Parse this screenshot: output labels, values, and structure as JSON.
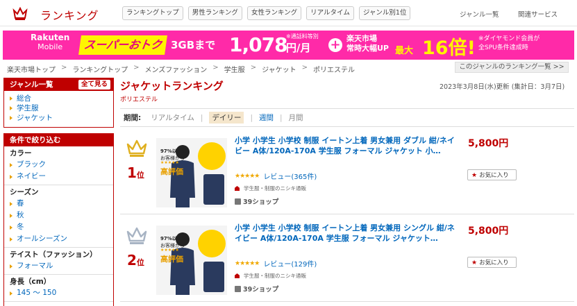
{
  "header": {
    "logo_text": "ランキング",
    "tabs": [
      "ランキングトップ",
      "男性ランキング",
      "女性ランキング",
      "リアルタイム",
      "ジャンル別1位"
    ],
    "right_links": [
      "ジャンル一覧",
      "関連サービス"
    ]
  },
  "banner": {
    "brand_top": "Rakuten",
    "brand_bottom": "Mobile",
    "super_deal": "スーパーおトク",
    "plan": "3GBまで",
    "price": "1,078",
    "price_unit": "円/月",
    "price_note": "※通話料等別",
    "ichiba_line1": "楽天市場",
    "ichiba_line2": "常時大幅UP",
    "max_label": "最大",
    "multiplier": "16倍!",
    "note_line1": "※ダイヤモンド会員が",
    "note_line2": "全SPU条件達成時"
  },
  "breadcrumb": [
    "楽天市場トップ",
    "ランキングトップ",
    "メンズファッション",
    "学生服",
    "ジャケット",
    "ポリエステル"
  ],
  "genre_list_link": "このジャンルのランキング一覧 >>",
  "sidebar": {
    "genre_title": "ジャンル一覧",
    "all_button": "全て見る",
    "genres": [
      "総合",
      "学生服",
      "ジャケット"
    ],
    "filter_title": "条件で絞り込む",
    "filters": [
      {
        "title": "カラー",
        "items": [
          "ブラック",
          "ネイビー"
        ]
      },
      {
        "title": "シーズン",
        "items": [
          "春",
          "秋",
          "冬",
          "オールシーズン"
        ]
      },
      {
        "title": "テイスト（ファッション）",
        "items": [
          "フォーマル"
        ]
      },
      {
        "title": "身長（cm）",
        "items": [
          "145 ～ 150"
        ]
      }
    ]
  },
  "main": {
    "title": "ジャケットランキング",
    "subtitle": "ポリエステル",
    "update_text": "2023年3月8日(水)更新 (集計日：3月7日)",
    "period_label": "期間:",
    "periods": [
      "リアルタイム",
      "デイリー",
      "週間",
      "月間"
    ]
  },
  "items": [
    {
      "rank": "1",
      "rank_suffix": "位",
      "title": "小学 小学生 小学校 制服 イートン上着 男女兼用 ダブル 紺/ネイビー A体/120A-170A 学生服 フォーマル ジャケット 小…",
      "stars": "★★★★★",
      "review": "レビュー(365件)",
      "shop": "学生服・制服のニシキ通販",
      "shop_badge": "39ショップ",
      "price": "5,800円",
      "fav": "お気に入り",
      "thumb_line1": "97%以上の",
      "thumb_line2": "お客様から",
      "thumb_line3": "高評価",
      "crown_color": "#e0b020"
    },
    {
      "rank": "2",
      "rank_suffix": "位",
      "title": "小学 小学生 小学校 制服 イートン上着 男女兼用 シングル 紺/ネイビー A体/120A-170A 学生服 フォーマル ジャケット…",
      "stars": "★★★★★",
      "review": "レビュー(129件)",
      "shop": "学生服・制服のニシキ通販",
      "shop_badge": "39ショップ",
      "price": "5,800円",
      "fav": "お気に入り",
      "thumb_line1": "97%以上の",
      "thumb_line2": "お客様から",
      "thumb_line3": "高評価",
      "crown_color": "#a8b4c4"
    }
  ]
}
